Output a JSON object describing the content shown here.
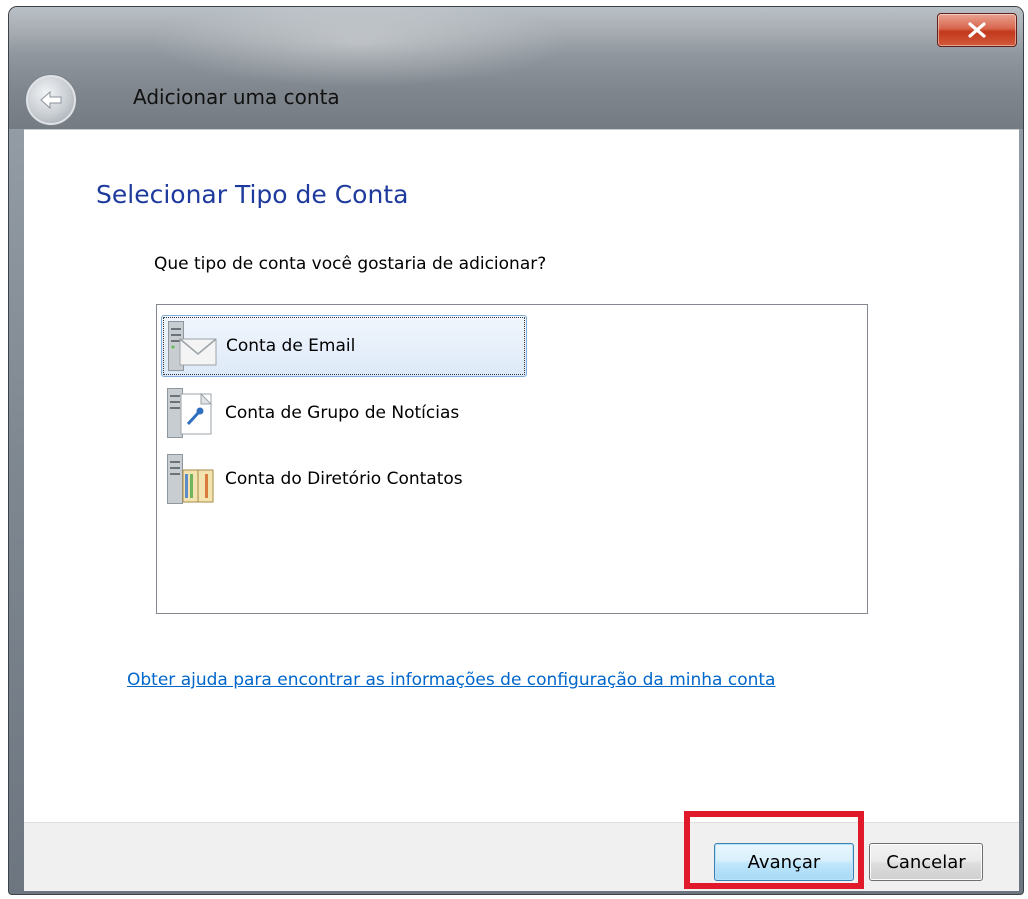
{
  "window": {
    "title": "Adicionar uma conta",
    "close_glyph": "X"
  },
  "page": {
    "heading": "Selecionar Tipo de Conta",
    "question": "Que tipo de conta você gostaria de adicionar?"
  },
  "account_types": [
    {
      "label": "Conta de Email",
      "icon": "server-mail-icon",
      "selected": true
    },
    {
      "label": "Conta de Grupo de Notícias",
      "icon": "server-news-icon",
      "selected": false
    },
    {
      "label": "Conta do Diretório Contatos",
      "icon": "server-directory-icon",
      "selected": false
    }
  ],
  "help_link": "Obter ajuda para encontrar as informações de configuração da minha conta",
  "buttons": {
    "next": "Avançar",
    "cancel": "Cancelar"
  },
  "colors": {
    "heading": "#1e3a9c",
    "link": "#0066cc",
    "highlight": "#e0192b"
  }
}
